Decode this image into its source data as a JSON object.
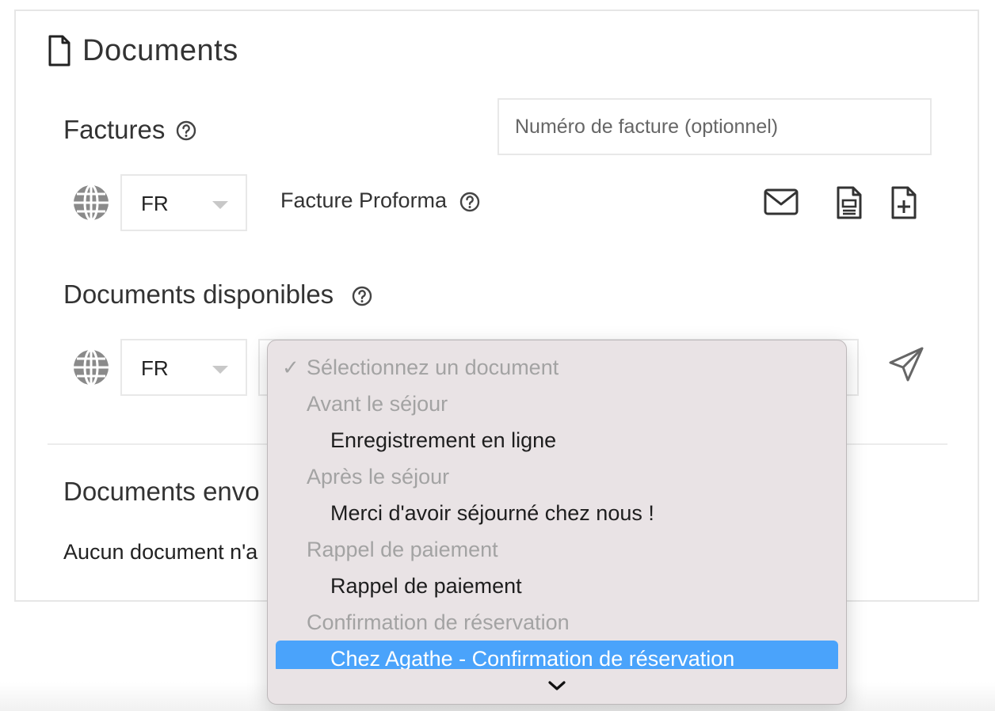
{
  "documents": {
    "title": "Documents",
    "invoices": {
      "title": "Factures",
      "invoice_number_placeholder": "Numéro de facture (optionnel)",
      "language": "FR",
      "proforma_label": "Facture Proforma"
    },
    "available": {
      "title": "Documents disponibles",
      "language": "FR"
    },
    "sent": {
      "title": "Documents envo",
      "empty_text": "Aucun document n'a"
    }
  },
  "dropdown": {
    "placeholder": "Sélectionnez un document",
    "checkmark": "✓",
    "groups": [
      {
        "label": "Avant le séjour",
        "items": [
          "Enregistrement en ligne"
        ]
      },
      {
        "label": "Après le séjour",
        "items": [
          "Merci d'avoir séjourné chez nous !"
        ]
      },
      {
        "label": "Rappel de paiement",
        "items": [
          "Rappel de paiement"
        ]
      },
      {
        "label": "Confirmation de réservation",
        "items": [
          "Chez Agathe - Confirmation de réservation"
        ]
      }
    ],
    "highlighted_item": "Chez Agathe - Confirmation de réservation"
  },
  "colors": {
    "highlight": "#4aa3fb",
    "dropdown_bg": "#e9e3e5"
  }
}
